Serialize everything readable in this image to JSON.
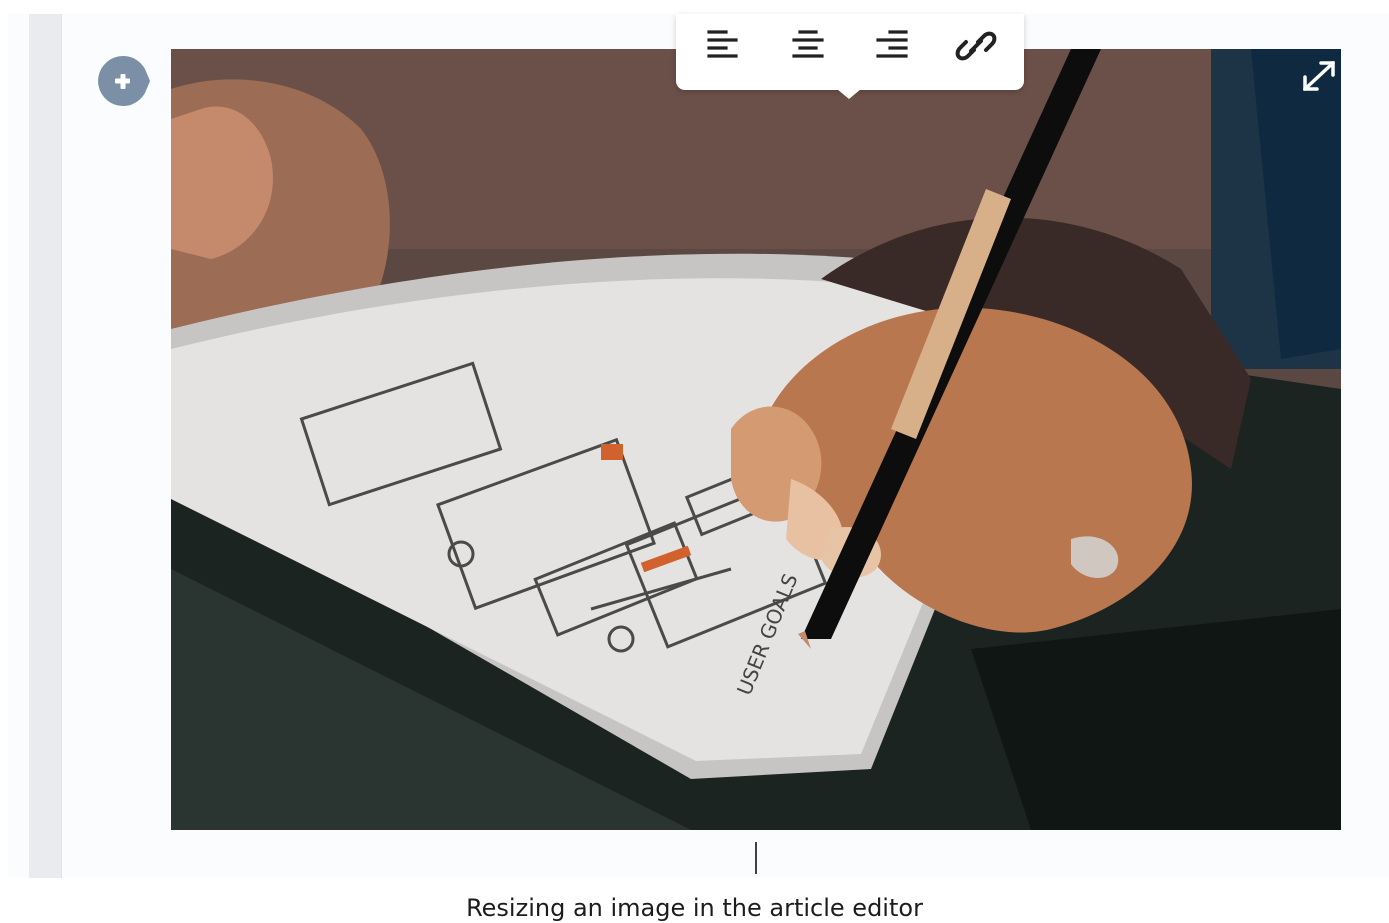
{
  "editor": {
    "add_block_icon": "plus-circle-icon",
    "expand_icon": "expand-arrows-icon"
  },
  "toolbar": {
    "items": [
      {
        "name": "align-left",
        "icon": "align-left-icon"
      },
      {
        "name": "align-center",
        "icon": "align-center-icon"
      },
      {
        "name": "align-right",
        "icon": "align-right-icon"
      },
      {
        "name": "link",
        "icon": "link-icon"
      }
    ]
  },
  "image": {
    "subject": "hand-sketching-wireframes-photo",
    "sketch_text": "USER GOALS"
  },
  "caption": {
    "text": "Resizing an image in the article editor"
  },
  "colors": {
    "accent_button": "#7b8fa6",
    "toolbar_bg": "#ffffff",
    "rail": "#e9ebee",
    "page_bg": "#fbfcfd"
  }
}
